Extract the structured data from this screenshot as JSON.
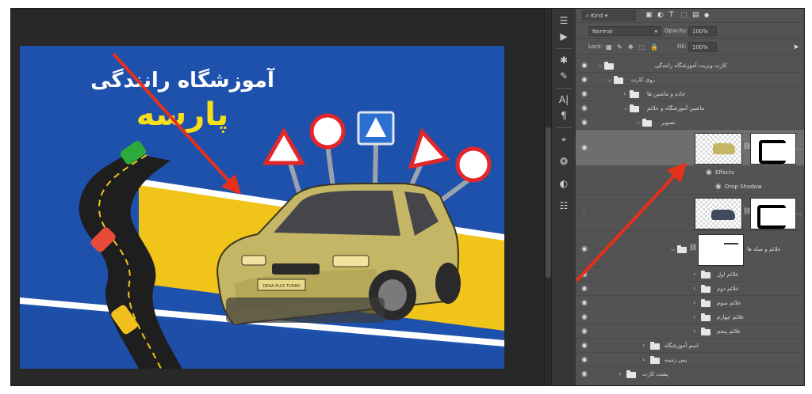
{
  "toolstrip": {
    "icons": [
      "adjust-icon",
      "play-icon",
      "gear-icon",
      "brush-icon",
      "type-icon",
      "paragraph-icon",
      "transform-icon",
      "three-circles-icon",
      "circle-half-icon",
      "sliders-icon"
    ]
  },
  "layers_panel": {
    "filter": {
      "kind_label": "Kind",
      "icons": [
        "image-filter-icon",
        "circle-half-icon",
        "T",
        "crop-icon",
        "lock-icon"
      ]
    },
    "blend_mode": "Normal",
    "opacity_label": "Opacity:",
    "opacity_value": "100%",
    "lock_label": "Lock:",
    "fill_label": "Fill:",
    "fill_value": "100%",
    "rows": [
      {
        "name": "کارت ویزیت آموزشگاه رانندگی",
        "type": "group"
      },
      {
        "name": "روی کارت",
        "type": "group"
      },
      {
        "name": "جاده و ماشین ها",
        "type": "group"
      },
      {
        "name": "ماشین آموزشگاه و علائم",
        "type": "group"
      },
      {
        "name": "تصویر",
        "type": "group"
      },
      {
        "name": "",
        "type": "layer-selected"
      },
      {
        "name": "Effects",
        "type": "effects"
      },
      {
        "name": "Drop Shadow",
        "type": "effect"
      },
      {
        "name": "",
        "type": "layer"
      },
      {
        "name": "علائم و میله ها",
        "type": "group"
      },
      {
        "name": "علائم اول",
        "type": "group"
      },
      {
        "name": "علائم دوم",
        "type": "group"
      },
      {
        "name": "علائم سوم",
        "type": "group"
      },
      {
        "name": "علائم چهارم",
        "type": "group"
      },
      {
        "name": "علائم پنجم",
        "type": "group"
      },
      {
        "name": "اسم آموزشگاه",
        "type": "group"
      },
      {
        "name": "پس زمینه",
        "type": "group"
      },
      {
        "name": "پشت کارت",
        "type": "group"
      }
    ]
  },
  "document": {
    "title_line1": "آموزشگاه رانندگی",
    "title_line2": "پارسه",
    "plate_text": "DENA PLUS TURBO"
  },
  "colors": {
    "brand_blue": "#1d4fa8",
    "brand_yellow": "#f0c418",
    "arrow_red": "#e6301a",
    "panel_bg": "#535353",
    "selected_row": "#6e6e6e"
  }
}
